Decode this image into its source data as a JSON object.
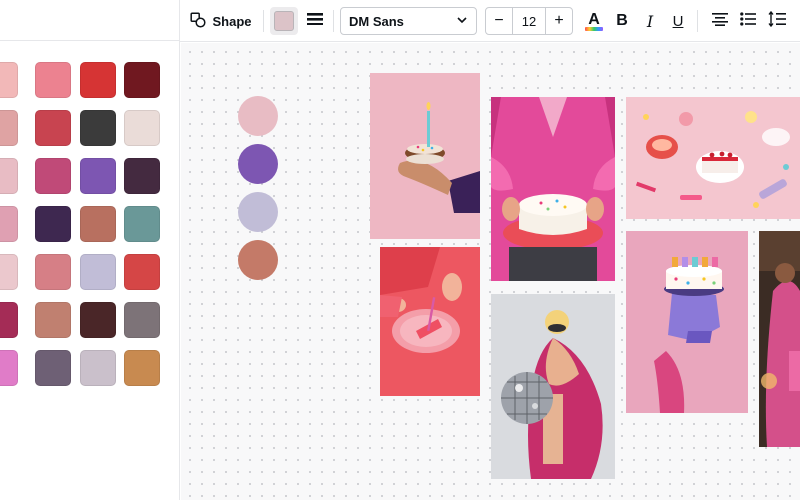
{
  "toolbar": {
    "shape_label": "Shape",
    "fill_color": "#dcc3c8",
    "font_name": "DM Sans",
    "font_size": "12",
    "bold_glyph": "B",
    "italic_glyph": "I",
    "underline_glyph": "U",
    "minus_glyph": "−",
    "plus_glyph": "+",
    "text_color_glyph": "A"
  },
  "icons": {
    "shape": "shapes-icon",
    "border": "border-style-icon",
    "dropdown": "chevron-down-icon",
    "text_color": "text-color-icon",
    "align": "align-center-icon",
    "list": "bullet-list-icon",
    "spacing": "line-spacing-icon"
  },
  "swatches": [
    [
      "#f2b8b8",
      "#ec8290",
      "#d63434",
      "#701820"
    ],
    [
      "#dfa3a3",
      "#c84450",
      "#3b3b3b",
      "#eadcd8"
    ],
    [
      "#e8bcc4",
      "#c04a78",
      "#7d56b2",
      "#442a40"
    ],
    [
      "#dfa0b2",
      "#3e2850",
      "#b87060",
      "#6a9898"
    ],
    [
      "#ebc8cd",
      "#d67f86",
      "#c1bdd7",
      "#d54646"
    ],
    [
      "#a42c56",
      "#c08070",
      "#4a2628",
      "#7d7378"
    ],
    [
      "#e07cc8",
      "#6e6075",
      "#cac0cb",
      "#c88a50"
    ]
  ],
  "palette_dots": [
    "#e8bcc4",
    "#7d56b2",
    "#c1bdd7",
    "#c47a68"
  ]
}
